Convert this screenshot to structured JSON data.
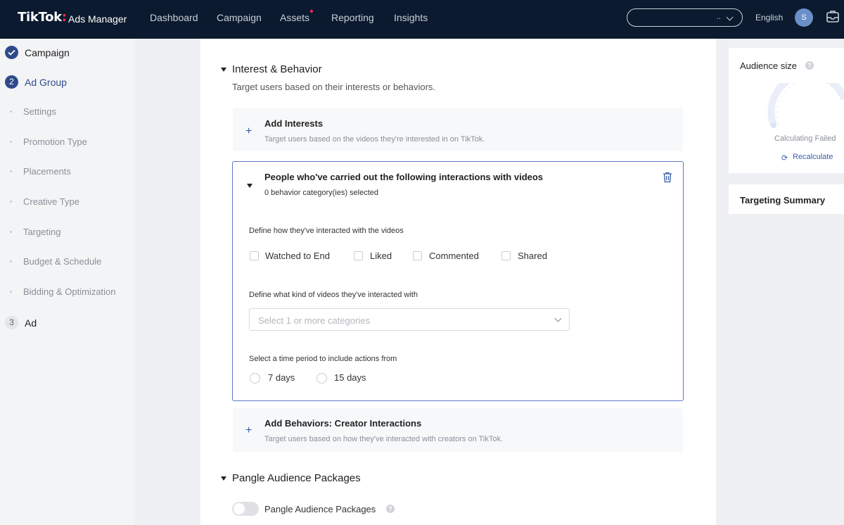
{
  "brand": {
    "logo": "TikTok",
    "colon": ":",
    "product": "Ads Manager"
  },
  "nav": {
    "items": [
      "Dashboard",
      "Campaign",
      "Assets",
      "Reporting",
      "Insights"
    ],
    "search_value": "..",
    "language": "English",
    "avatar_initial": "S"
  },
  "sidebar": {
    "steps": [
      {
        "number": "",
        "label": "Campaign",
        "state": "done"
      },
      {
        "number": "2",
        "label": "Ad Group",
        "state": "active"
      },
      {
        "number": "3",
        "label": "Ad",
        "state": "pending"
      }
    ],
    "substeps": [
      "Settings",
      "Promotion Type",
      "Placements",
      "Creative Type",
      "Targeting",
      "Budget & Schedule",
      "Bidding & Optimization"
    ]
  },
  "main": {
    "interest_section": {
      "title": "Interest & Behavior",
      "subtitle": "Target users based on their interests or behaviors."
    },
    "add_interests": {
      "title": "Add Interests",
      "desc": "Target users based on the videos they're interested in on TikTok."
    },
    "behavior": {
      "title": "People who've carried out the following interactions with videos",
      "count": "0 behavior category(ies) selected",
      "interaction_label": "Define how they've interacted with the videos",
      "checkboxes": [
        "Watched to End",
        "Liked",
        "Commented",
        "Shared"
      ],
      "category_label": "Define what kind of videos they've interacted with",
      "category_placeholder": "Select 1 or more categories",
      "time_label": "Select a time period to include actions from",
      "time_options": [
        "7 days",
        "15 days"
      ]
    },
    "add_creator": {
      "title": "Add Behaviors: Creator Interactions",
      "desc": "Target users based on how they've interacted with creators on TikTok."
    },
    "pangle_section": {
      "title": "Pangle Audience Packages",
      "toggle_label": "Pangle Audience Packages"
    }
  },
  "right": {
    "audience_title": "Audience size",
    "calc_status": "Calculating Failed",
    "recalc": "Recalculate",
    "summary_title": "Targeting Summary"
  },
  "colors": {
    "nav_bg": "#0b1a2e",
    "accent": "#2e4a8a",
    "link": "#3a5ea8",
    "active_border": "#5b7ac7",
    "notification": "#fe2c55"
  }
}
